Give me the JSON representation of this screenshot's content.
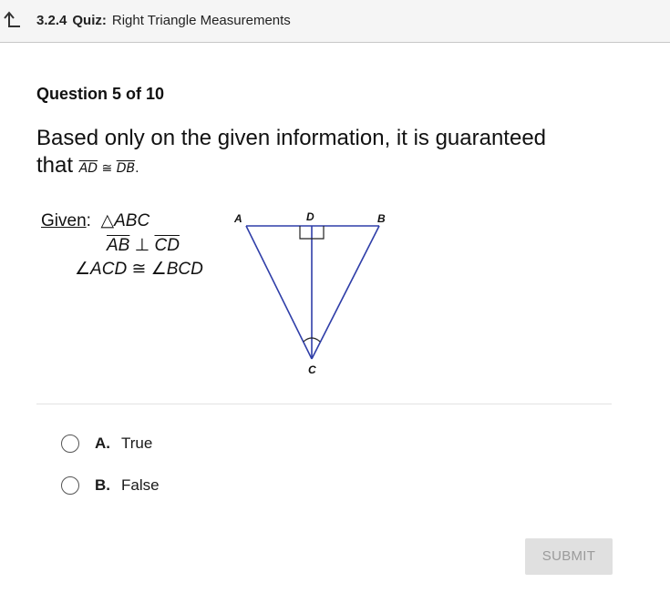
{
  "header": {
    "quiz_number": "3.2.4",
    "quiz_kind": "Quiz:",
    "quiz_title": "Right Triangle Measurements",
    "back_icon": "back-arrow-icon"
  },
  "question": {
    "counter": "Question 5 of 10",
    "prompt_line1": "Based only on the given information, it is guaranteed",
    "prompt_that": "that",
    "seg1": "AD",
    "congruent": "≅",
    "seg2": "DB",
    "period": "."
  },
  "given": {
    "label": "Given",
    "colon": ":",
    "triangle_symbol": "△",
    "triangle_name": "ABC",
    "seg_ab": "AB",
    "perp": "⊥",
    "seg_cd": "CD",
    "angle_symbol": "∠",
    "angle1": "ACD",
    "congruent": "≅",
    "angle2": "BCD"
  },
  "diagram": {
    "label_a": "A",
    "label_d": "D",
    "label_b": "B",
    "label_c": "C",
    "line_color": "#2f3ea8"
  },
  "options": [
    {
      "letter": "A.",
      "text": "True"
    },
    {
      "letter": "B.",
      "text": "False"
    }
  ],
  "submit_label": "SUBMIT"
}
